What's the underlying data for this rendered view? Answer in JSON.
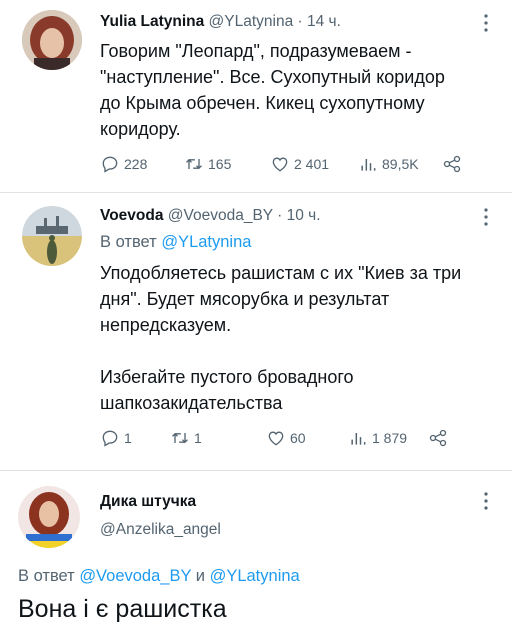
{
  "tweets": [
    {
      "name": "Yulia Latynina",
      "handle": "@YLatynina",
      "time": "· 14 ч.",
      "text": "Говорим \"Леопард\", подразумеваем -\n\"наступление\".  Все. Сухопутный коридор\nдо Крыма обречен. Кикец сухопутному\nкоридору.",
      "replies": "228",
      "retweets": "165",
      "likes": "2 401",
      "views": "89,5K"
    },
    {
      "name": "Voevoda",
      "handle": "@Voevoda_BY",
      "time": "· 10 ч.",
      "reply_prefix": "В ответ ",
      "reply_target": "@YLatynina",
      "text": "Уподобляетесь рашистам с их \"Киев за три\nдня\". Будет мясорубка и результат\nнепредсказуем.\n\nИзбегайте пустого бровадного\nшапкозакидательства",
      "replies": "1",
      "retweets": "1",
      "likes": "60",
      "views": "1 879"
    },
    {
      "name": "Дика штучка",
      "handle": "@Anzelika_angel",
      "reply_prefix": "В ответ ",
      "reply_target_1": "@Voevoda_BY",
      "reply_and": " и ",
      "reply_target_2": "@YLatynina",
      "text": "Вона і є рашистка"
    }
  ],
  "icons": [
    "reply-icon",
    "retweet-icon",
    "like-icon",
    "views-icon",
    "share-icon",
    "more-icon"
  ],
  "colors": {
    "accent": "#1d9bf0",
    "muted": "#536471",
    "text": "#0f1419"
  }
}
